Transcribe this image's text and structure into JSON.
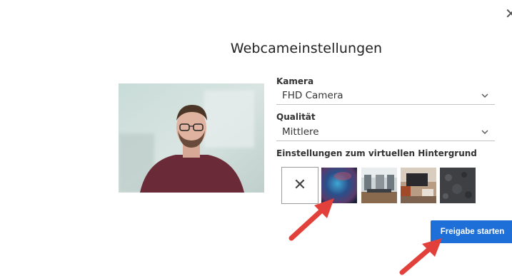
{
  "dialog": {
    "title": "Webcameinstellungen",
    "close_icon": "close-icon"
  },
  "camera": {
    "label": "Kamera",
    "value": "FHD Camera"
  },
  "quality": {
    "label": "Qualität",
    "value": "Mittlere"
  },
  "virtual_background": {
    "label": "Einstellungen zum virtuellen Hintergrund",
    "options": [
      "none",
      "blue-abstract",
      "office",
      "living-room",
      "dark-texture"
    ],
    "none_icon": "close-icon"
  },
  "start_button": {
    "label": "Freigabe starten"
  },
  "colors": {
    "accent": "#1f6fd8",
    "arrow": "#e2403a"
  }
}
